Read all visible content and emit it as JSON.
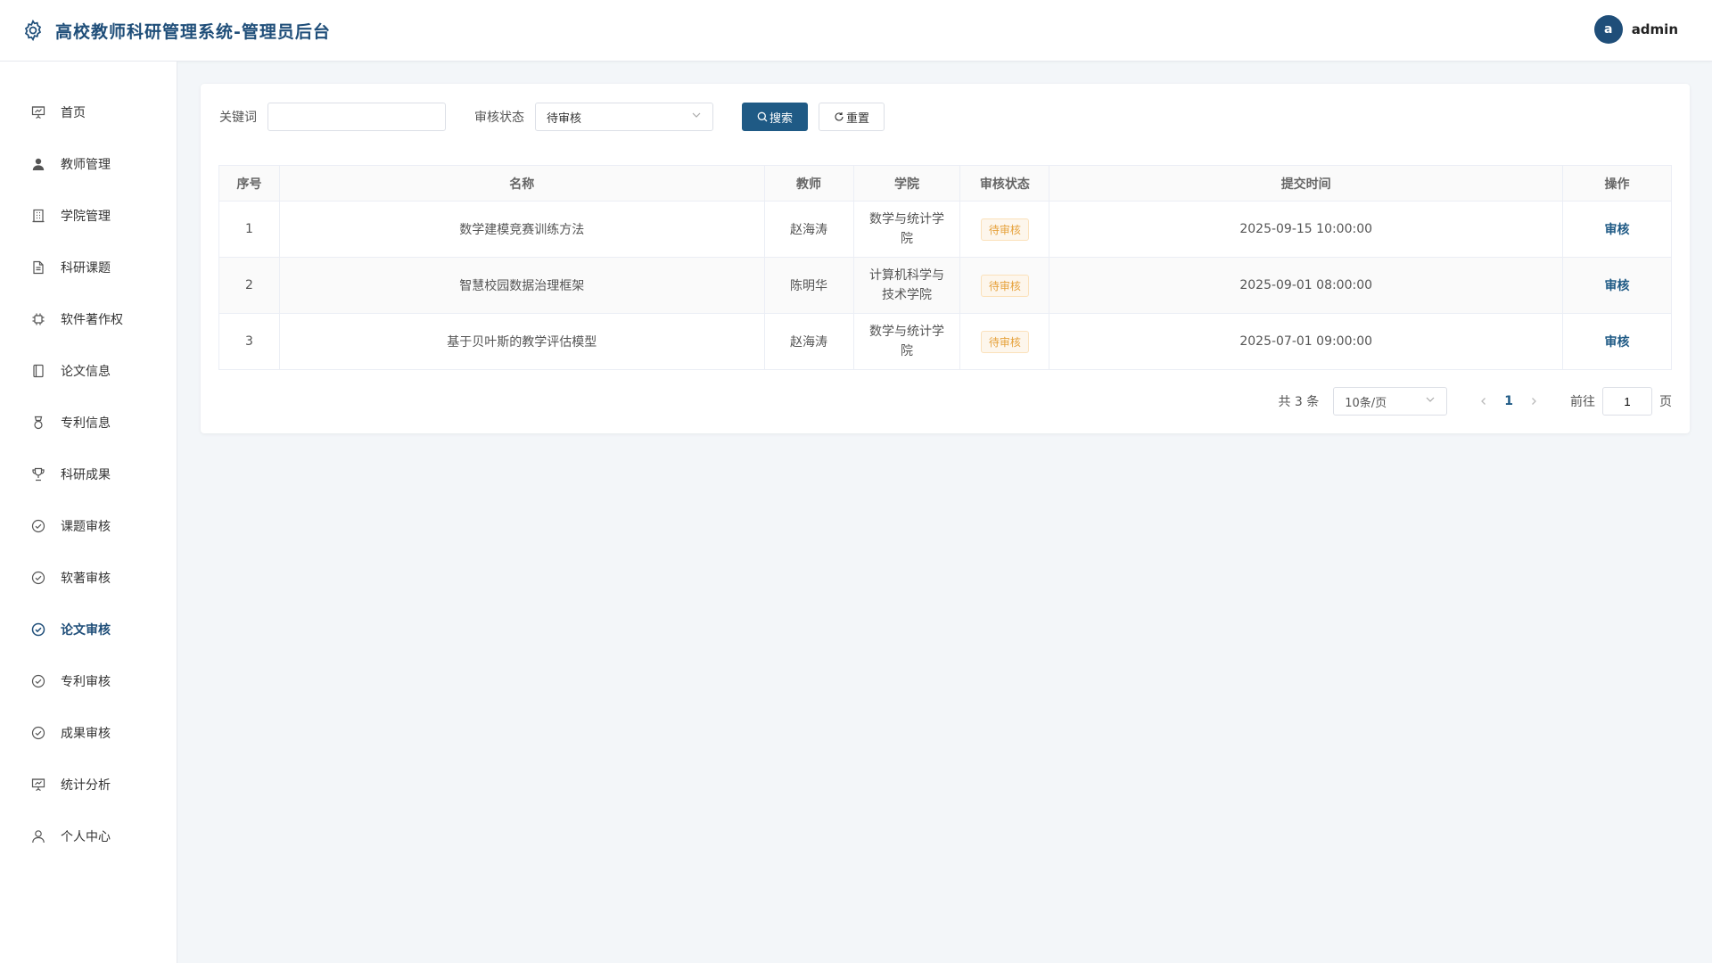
{
  "header": {
    "title": "高校教师科研管理系统-管理员后台",
    "avatar_letter": "a",
    "username": "admin"
  },
  "sidebar": {
    "items": [
      {
        "label": "首页",
        "icon": "presentation-icon"
      },
      {
        "label": "教师管理",
        "icon": "user-filled-icon"
      },
      {
        "label": "学院管理",
        "icon": "building-icon"
      },
      {
        "label": "科研课题",
        "icon": "document-icon"
      },
      {
        "label": "软件著作权",
        "icon": "chip-icon"
      },
      {
        "label": "论文信息",
        "icon": "notebook-icon"
      },
      {
        "label": "专利信息",
        "icon": "medal-icon"
      },
      {
        "label": "科研成果",
        "icon": "trophy-icon"
      },
      {
        "label": "课题审核",
        "icon": "circle-check-icon"
      },
      {
        "label": "软著审核",
        "icon": "circle-check-icon"
      },
      {
        "label": "论文审核",
        "icon": "circle-check-icon",
        "active": true
      },
      {
        "label": "专利审核",
        "icon": "circle-check-icon"
      },
      {
        "label": "成果审核",
        "icon": "circle-check-icon"
      },
      {
        "label": "统计分析",
        "icon": "chart-board-icon"
      },
      {
        "label": "个人中心",
        "icon": "user-icon"
      }
    ]
  },
  "filters": {
    "keyword_label": "关键词",
    "keyword_value": "",
    "status_label": "审核状态",
    "status_value": "待审核",
    "search_label": "搜索",
    "reset_label": "重置"
  },
  "table": {
    "columns": [
      "序号",
      "名称",
      "教师",
      "学院",
      "审核状态",
      "提交时间",
      "操作"
    ],
    "rows": [
      {
        "index": "1",
        "name": "数学建模竞赛训练方法",
        "teacher": "赵海涛",
        "college_l1": "数学与统计学",
        "college_l2": "院",
        "status": "待审核",
        "time": "2025-09-15 10:00:00",
        "action": "审核"
      },
      {
        "index": "2",
        "name": "智慧校园数据治理框架",
        "teacher": "陈明华",
        "college_l1": "计算机科学与",
        "college_l2": "技术学院",
        "status": "待审核",
        "time": "2025-09-01 08:00:00",
        "action": "审核"
      },
      {
        "index": "3",
        "name": "基于贝叶斯的教学评估模型",
        "teacher": "赵海涛",
        "college_l1": "数学与统计学",
        "college_l2": "院",
        "status": "待审核",
        "time": "2025-07-01 09:00:00",
        "action": "审核"
      }
    ]
  },
  "pagination": {
    "total_text": "共 3 条",
    "page_size": "10条/页",
    "current_page": "1",
    "goto_label": "前往",
    "goto_value": "1",
    "page_suffix": "页"
  },
  "colors": {
    "brand": "#1f4e79",
    "primary_button": "#1f5a85",
    "warning_tag": "#e6a23c"
  }
}
